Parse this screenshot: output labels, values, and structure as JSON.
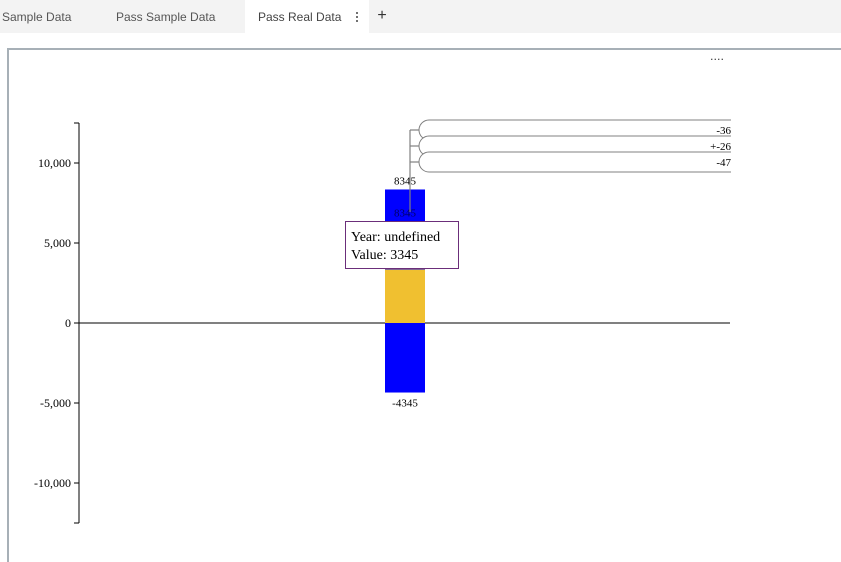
{
  "tabs": [
    {
      "label": "Sample Data",
      "active": false
    },
    {
      "label": "Pass Sample Data",
      "active": false
    },
    {
      "label": "Pass Real Data",
      "active": true
    }
  ],
  "add_tab_label": "+",
  "panel": {
    "more_label": "...."
  },
  "chart_data": {
    "type": "bar",
    "ylim": [
      -12500,
      12500
    ],
    "ytick_labels": [
      "10,000",
      "5,000",
      "0",
      "-5,000",
      "-10,000"
    ],
    "ytick_values": [
      10000,
      5000,
      0,
      -5000,
      -10000
    ],
    "bars": [
      {
        "value": 8345,
        "label": "8345",
        "color": "#0000ff"
      },
      {
        "value": 3345,
        "label": "",
        "color": "#f0c030"
      },
      {
        "value": -4345,
        "label": "-4345",
        "color": "#0000ff"
      }
    ],
    "overlay_label": "8345",
    "callouts": [
      "-36",
      "+-26",
      "-47"
    ],
    "tooltip": {
      "line1": "Year: undefined",
      "line2": "Value: 3345"
    }
  }
}
